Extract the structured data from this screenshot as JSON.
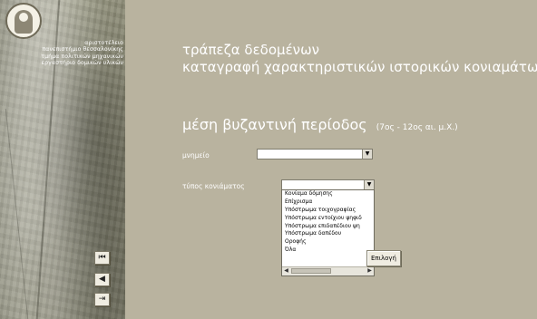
{
  "sidebar": {
    "institution_lines": [
      "αριστοτέλειο",
      "πανεπιστήμιο θεσσαλονίκης",
      "τμήμα πολιτικών μηχανικών",
      "εργαστήριο δομικών υλικών"
    ],
    "nav": {
      "first": "⏮",
      "back": "◀",
      "exit": "⇥"
    }
  },
  "main": {
    "title_line1": "τράπεζα δεδομένων",
    "title_line2": "καταγραφή χαρακτηριστικών ιστορικών κονιαμάτων",
    "period_name": "μέση βυζαντινή περίοδος",
    "period_dates": "(7ος - 12ος αι. μ.Χ.)",
    "monument_label": "μνημείο",
    "monument_value": "",
    "mortar_type_label": "τύπος κονιάματος",
    "mortar_type_value": "",
    "mortar_type_options": [
      "Κονίαμα δόμησης",
      "Επίχρισμα",
      "Υπόστρωμα τοιχογραφίας",
      "Υπόστρωμα εντοίχιου ψηφιδ",
      "Υπόστρωμα επιδαπέδιου ψη",
      "Υπόστρωμα δαπέδου",
      "Οροφής",
      "Όλα"
    ],
    "select_button_label": "Επιλογή"
  }
}
